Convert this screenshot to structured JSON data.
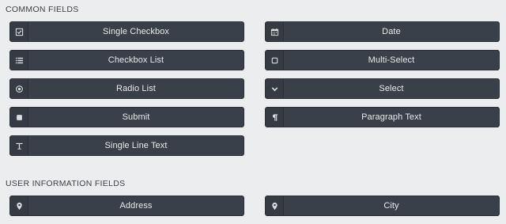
{
  "sections": {
    "common": {
      "title": "COMMON FIELDS",
      "fields": [
        {
          "label": "Single Checkbox",
          "icon": "checkbox-check-icon"
        },
        {
          "label": "Date",
          "icon": "calendar-icon"
        },
        {
          "label": "Checkbox List",
          "icon": "list-icon"
        },
        {
          "label": "Multi-Select",
          "icon": "square-outline-icon"
        },
        {
          "label": "Radio List",
          "icon": "radio-icon"
        },
        {
          "label": "Select",
          "icon": "chevron-down-icon"
        },
        {
          "label": "Submit",
          "icon": "square-filled-icon"
        },
        {
          "label": "Paragraph Text",
          "icon": "pilcrow-icon"
        },
        {
          "label": "Single Line Text",
          "icon": "text-cursor-icon"
        }
      ]
    },
    "user_info": {
      "title": "USER INFORMATION FIELDS",
      "fields": [
        {
          "label": "Address",
          "icon": "map-pin-icon"
        },
        {
          "label": "City",
          "icon": "map-pin-icon"
        }
      ]
    }
  },
  "colors": {
    "background": "#ecedef",
    "button_bg": "#3a4049",
    "button_text": "#e8eaed"
  }
}
